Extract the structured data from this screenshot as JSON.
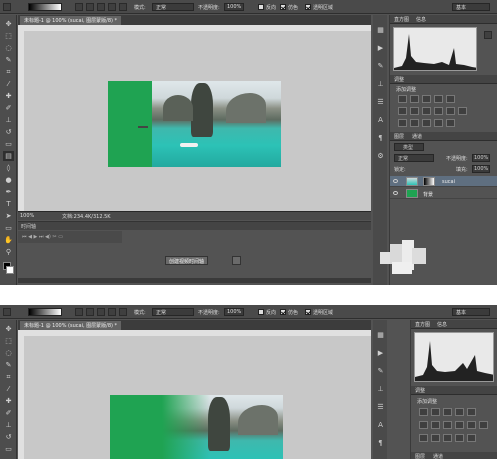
{
  "top": {
    "options": {
      "mode_label": "模式:",
      "mode_value": "正常",
      "opacity_label": "不透明度:",
      "opacity_value": "100%",
      "reverse_label": "反向",
      "dither_label": "仿色",
      "transparency_label": "透明区域",
      "workspace": "基本"
    },
    "doc_tab": "未标题-1 @ 100% (sucai, 图层蒙版/8) *",
    "status": {
      "zoom": "100%",
      "doc": "文档:234.4K/312.5K"
    },
    "timeline": {
      "title": "时间轴",
      "create_button": "创建视频时间轴"
    },
    "histogram": {
      "tab1": "直方图",
      "tab2": "信息"
    },
    "adjustments": {
      "tab1": "调整",
      "subtitle": "添加调整"
    },
    "layers": {
      "tab1": "图层",
      "tab2": "通道",
      "kind": "类型",
      "blend": "正常",
      "opacity_label": "不透明度:",
      "opacity_value": "100%",
      "lock_label": "锁定:",
      "fill_label": "填充:",
      "fill_value": "100%",
      "items": [
        {
          "name": "sucai"
        },
        {
          "name": "背景"
        }
      ]
    }
  },
  "bottom": {
    "options": {
      "mode_label": "模式:",
      "mode_value": "正常",
      "opacity_label": "不透明度:",
      "opacity_value": "100%",
      "reverse_label": "反向",
      "dither_label": "仿色",
      "transparency_label": "透明区域",
      "workspace": "基本"
    },
    "doc_tab": "未标题-1 @ 100% (sucai, 图层蒙版/8) *",
    "histogram": {
      "tab1": "直方图",
      "tab2": "信息"
    },
    "adjustments": {
      "tab1": "调整",
      "subtitle": "添加调整"
    },
    "layers": {
      "tab1": "图层",
      "tab2": "通道"
    }
  },
  "colors": {
    "green": "#1fa352",
    "canvas_gray": "#c8c8c8",
    "ui_dark": "#535353"
  }
}
